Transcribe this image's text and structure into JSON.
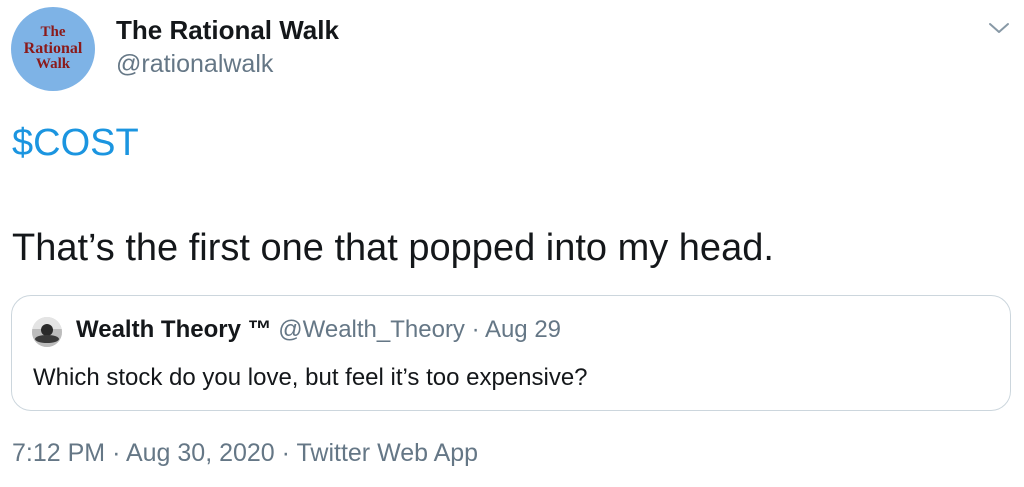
{
  "author": {
    "avatar_text": [
      "The",
      "Rational",
      "Walk"
    ],
    "display_name": "The Rational Walk",
    "handle": "@rationalwalk"
  },
  "menu": {
    "icon": "chevron-down-icon"
  },
  "tweet": {
    "cashtag": "$COST",
    "text": "That’s the first one that popped into my head."
  },
  "quote": {
    "display_name": "Wealth Theory ™",
    "handle": "@Wealth_Theory",
    "separator": "·",
    "date": "Aug 29",
    "text": "Which stock do you love, but feel it’s too expensive?"
  },
  "footer": {
    "time": "7:12 PM",
    "separator": "·",
    "date": "Aug 30, 2020",
    "source": "Twitter Web App"
  },
  "colors": {
    "link_blue": "#1b95e0",
    "secondary_gray": "#657786",
    "border": "#ccd6dd",
    "avatar_bg": "#7eb3e6",
    "avatar_text": "#8b1a1a"
  }
}
